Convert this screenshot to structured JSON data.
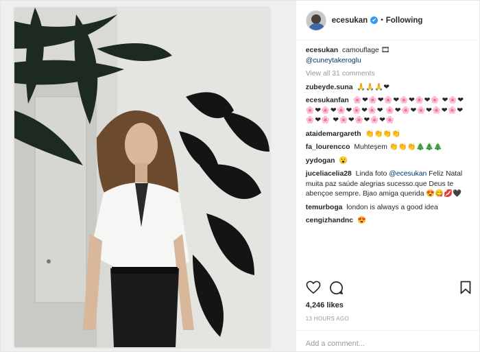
{
  "post": {
    "author": "ecesukan",
    "dot": "•",
    "follow_label": "Following",
    "caption": {
      "user": "ecesukan",
      "text": "camouflage 🎞",
      "mention": "@cuneytakeroglu"
    },
    "view_all": "View all 31 comments",
    "comments": [
      {
        "user": "zubeyde.suna",
        "text": "🙏🙏🙏❤"
      },
      {
        "user": "ecesukanfan",
        "text": "🌸❤🌸❤🌸❤🌸❤🌸❤🌸 ❤🌸❤🌸❤🌸❤🌸❤🌸❤🌸❤ 🌸❤🌸❤🌸❤🌸❤🌸❤🌸❤🌸 ❤🌸❤🌸❤🌸❤🌸"
      },
      {
        "user": "ataidemargareth",
        "text": "👏👏👏👏"
      },
      {
        "user": "fa_lourencco",
        "text": "Muhteşem 👏👏👏🎄🎄🎄"
      },
      {
        "user": "yydogan",
        "text": "😮"
      },
      {
        "user": "juceliacelia28",
        "text_before": "Linda foto",
        "mention": "@ecesukan",
        "text_after": "Feliz Natal muita paz saúde alegrias sucesso.que Deus te abençoe sempre. Bjao amiga querida 😍😋💋🖤"
      },
      {
        "user": "temurboga",
        "text": "london is always a good idea"
      },
      {
        "user": "cengizhandnc",
        "text": "😍"
      }
    ],
    "likes": "4,246 likes",
    "time": "13 HOURS AGO",
    "add_comment_placeholder": "Add a comment..."
  },
  "icons": {
    "verified": "✔",
    "heart": "heart-icon",
    "comment": "comment-icon",
    "bookmark": "bookmark-icon"
  },
  "colors": {
    "link": "#003569",
    "verified": "#3897f0",
    "muted": "#999999"
  }
}
